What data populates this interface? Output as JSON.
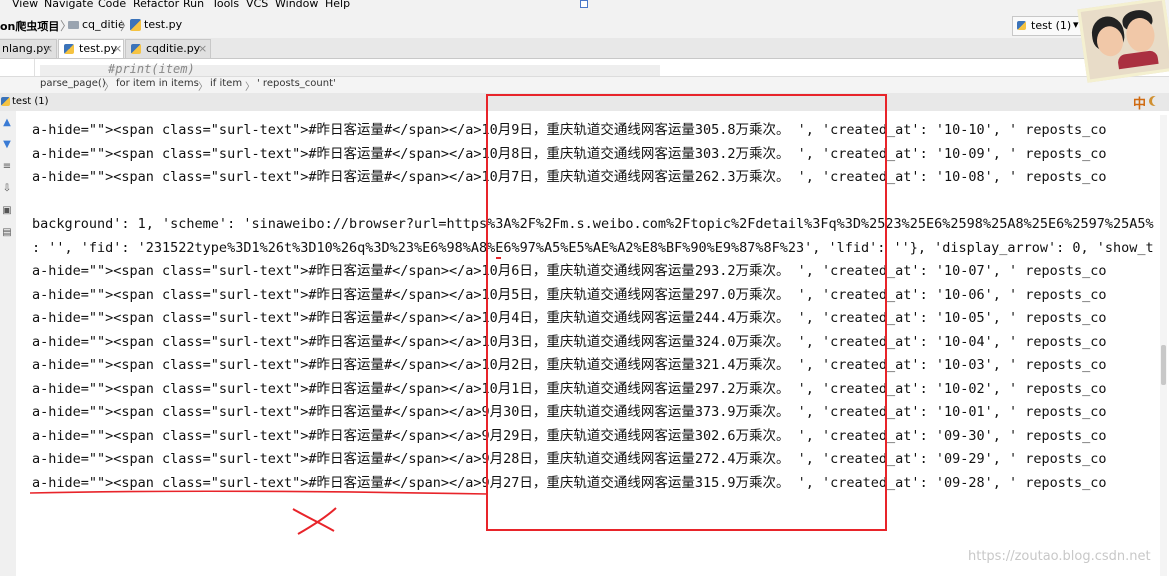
{
  "menu": [
    "View",
    "Navigate",
    "Code",
    "Refactor",
    "Run",
    "Tools",
    "VCS",
    "Window",
    "Help"
  ],
  "nav": {
    "project": "on爬虫项目",
    "folder": "cq_ditie",
    "file": "test.py",
    "sep": "〉"
  },
  "run_config": {
    "label": "test (1)",
    "arrow": "▾"
  },
  "tabs": [
    "nlang.py",
    "test.py",
    "cqditie.py"
  ],
  "tab_close": "×",
  "code_line": "#print(item)",
  "breadcrumb": [
    "parse_page()",
    "for item in items",
    "if item",
    "' reposts_count'"
  ],
  "run_tab": "test (1)",
  "ime": "中",
  "console_lines": [
    "a-hide=\"\"><span class=\"surl-text\">#昨日客运量#</span></a>10月9日，重庆轨道交通线网客运量305.8万乘次。 ', 'created_at': '10-10', ' reposts_co",
    "a-hide=\"\"><span class=\"surl-text\">#昨日客运量#</span></a>10月8日，重庆轨道交通线网客运量303.2万乘次。 ', 'created_at': '10-09', ' reposts_co",
    "a-hide=\"\"><span class=\"surl-text\">#昨日客运量#</span></a>10月7日，重庆轨道交通线网客运量262.3万乘次。 ', 'created_at': '10-08', ' reposts_co",
    "",
    "background': 1, 'scheme': 'sinaweibo://browser?url=https%3A%2F%2Fm.s.weibo.com%2Ftopic%2Fdetail%3Fq%3D%2523%25E6%2598%25A8%25E6%2597%25A5%",
    ": '', 'fid': '231522type%3D1%26t%3D10%26q%3D%23%E6%98%A8%E6%97%A5%E5%AE%A2%E8%BF%90%E9%87%8F%23', 'lfid': ''}, 'display_arrow': 0, 'show_t",
    "a-hide=\"\"><span class=\"surl-text\">#昨日客运量#</span></a>10月6日，重庆轨道交通线网客运量293.2万乘次。 ', 'created_at': '10-07', ' reposts_co",
    "a-hide=\"\"><span class=\"surl-text\">#昨日客运量#</span></a>10月5日，重庆轨道交通线网客运量297.0万乘次。 ', 'created_at': '10-06', ' reposts_co",
    "a-hide=\"\"><span class=\"surl-text\">#昨日客运量#</span></a>10月4日，重庆轨道交通线网客运量244.4万乘次。 ', 'created_at': '10-05', ' reposts_co",
    "a-hide=\"\"><span class=\"surl-text\">#昨日客运量#</span></a>10月3日，重庆轨道交通线网客运量324.0万乘次。 ', 'created_at': '10-04', ' reposts_co",
    "a-hide=\"\"><span class=\"surl-text\">#昨日客运量#</span></a>10月2日，重庆轨道交通线网客运量321.4万乘次。 ', 'created_at': '10-03', ' reposts_co",
    "a-hide=\"\"><span class=\"surl-text\">#昨日客运量#</span></a>10月1日，重庆轨道交通线网客运量297.2万乘次。 ', 'created_at': '10-02', ' reposts_co",
    "a-hide=\"\"><span class=\"surl-text\">#昨日客运量#</span></a>9月30日，重庆轨道交通线网客运量373.9万乘次。 ', 'created_at': '10-01', ' reposts_co",
    "a-hide=\"\"><span class=\"surl-text\">#昨日客运量#</span></a>9月29日，重庆轨道交通线网客运量302.6万乘次。 ', 'created_at': '09-30', ' reposts_co",
    "a-hide=\"\"><span class=\"surl-text\">#昨日客运量#</span></a>9月28日，重庆轨道交通线网客运量272.4万乘次。 ', 'created_at': '09-29', ' reposts_co",
    "a-hide=\"\"><span class=\"surl-text\">#昨日客运量#</span></a>9月27日，重庆轨道交通线网客运量315.9万乘次。 ', 'created_at': '09-28', ' reposts_co"
  ],
  "watermark": "https://zoutao.blog.csdn.net",
  "colors": {
    "annotation_red": "#e8242a",
    "console_bg": "#ffffff"
  }
}
